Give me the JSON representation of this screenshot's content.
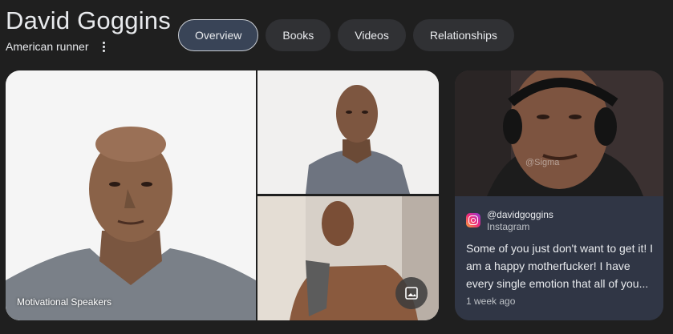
{
  "entity": {
    "title": "David Goggins",
    "subtitle": "American runner"
  },
  "tabs": [
    {
      "label": "Overview",
      "active": true
    },
    {
      "label": "Books",
      "active": false
    },
    {
      "label": "Videos",
      "active": false
    },
    {
      "label": "Relationships",
      "active": false
    }
  ],
  "images": {
    "main_caption": "Motivational Speakers",
    "icons": {
      "more": "more-vert-icon",
      "gallery": "image-gallery-icon"
    }
  },
  "instagram_card": {
    "handle": "@davidgoggins",
    "platform": "Instagram",
    "text": "Some of you just don't want to get it! I am a happy motherfucker! I have every single emotion that all of you...",
    "time": "1 week ago",
    "watermark": "@Sigma",
    "icon": "instagram-logo-icon"
  },
  "colors": {
    "background": "#1f1f1f",
    "tab_bg": "#303134",
    "tab_active_bg": "#394457",
    "card_body": "#303645",
    "text": "#e8eaed",
    "muted": "#bdc1c6"
  }
}
